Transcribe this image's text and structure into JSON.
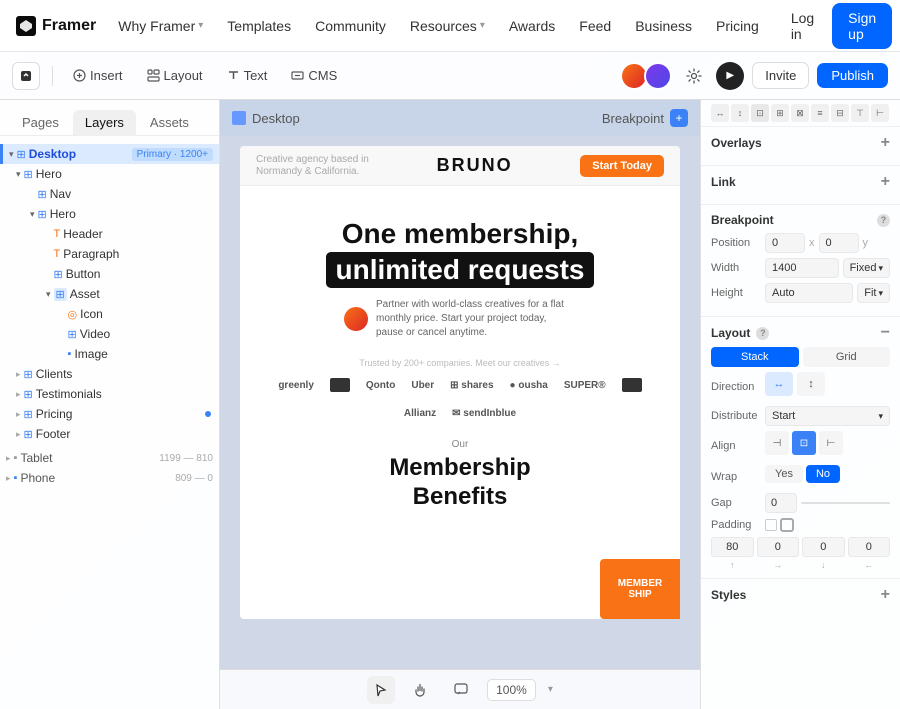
{
  "topnav": {
    "logo_text": "Framer",
    "items": [
      {
        "label": "Why Framer",
        "has_arrow": true
      },
      {
        "label": "Templates",
        "has_arrow": false
      },
      {
        "label": "Community",
        "has_arrow": false
      },
      {
        "label": "Resources",
        "has_arrow": true
      },
      {
        "label": "Awards",
        "has_arrow": false
      },
      {
        "label": "Feed",
        "has_arrow": false
      },
      {
        "label": "Business",
        "has_arrow": false
      },
      {
        "label": "Pricing",
        "has_arrow": false
      }
    ],
    "login_label": "Log in",
    "signup_label": "Sign up"
  },
  "editor": {
    "toolbar": {
      "insert_label": "Insert",
      "layout_label": "Layout",
      "text_label": "Text",
      "cms_label": "CMS",
      "invite_label": "Invite",
      "publish_label": "Publish"
    },
    "panels": {
      "tabs": [
        "Pages",
        "Layers",
        "Assets"
      ],
      "active_tab": "Layers"
    },
    "layers": [
      {
        "id": "desktop",
        "label": "Desktop",
        "indent": 0,
        "badge": "Primary · 1200+",
        "selected": true,
        "icon": "frame",
        "expanded": true
      },
      {
        "id": "hero",
        "label": "Hero",
        "indent": 1,
        "icon": "component",
        "expanded": true
      },
      {
        "id": "nav",
        "label": "Nav",
        "indent": 2,
        "icon": "component"
      },
      {
        "id": "hero2",
        "label": "Hero",
        "indent": 2,
        "icon": "component",
        "expanded": true
      },
      {
        "id": "header",
        "label": "Header",
        "indent": 3,
        "icon": "text"
      },
      {
        "id": "paragraph",
        "label": "Paragraph",
        "indent": 3,
        "icon": "text"
      },
      {
        "id": "button",
        "label": "Button",
        "indent": 3,
        "icon": "component"
      },
      {
        "id": "asset",
        "label": "Asset",
        "indent": 3,
        "icon": "component",
        "expanded": true
      },
      {
        "id": "icon",
        "label": "Icon",
        "indent": 4,
        "icon": "component"
      },
      {
        "id": "video",
        "label": "Video",
        "indent": 4,
        "icon": "component"
      },
      {
        "id": "image",
        "label": "Image",
        "indent": 4,
        "icon": "rect"
      },
      {
        "id": "clients",
        "label": "Clients",
        "indent": 1,
        "icon": "component"
      },
      {
        "id": "testimonials",
        "label": "Testimonials",
        "indent": 1,
        "icon": "component"
      },
      {
        "id": "pricing",
        "label": "Pricing",
        "indent": 1,
        "icon": "component"
      },
      {
        "id": "footer",
        "label": "Footer",
        "indent": 1,
        "icon": "component"
      }
    ],
    "breakpoints": [
      {
        "label": "Tablet",
        "range": "1199 — 810",
        "indent": 0
      },
      {
        "label": "Phone",
        "range": "809 — 0",
        "indent": 0
      }
    ],
    "canvas": {
      "frame_label": "Desktop",
      "breakpoint_label": "Breakpoint",
      "zoom": "100%"
    },
    "site_content": {
      "logo": "BRUNO",
      "cta_btn": "Start Today",
      "hero_line1": "One membership,",
      "hero_line2": "unlimited requests",
      "hero_sub": "Partner with world-class creatives for a flat monthly price. Start your project today, pause or cancel anytime.",
      "logos_credit": "Trusted by 200+ companies. Meet our creatives →",
      "logos": [
        "greenly",
        "□",
        "Qonto",
        "Uber",
        "☷ shares",
        "⬤ ousha",
        "SUPER®",
        "■",
        "Allianz",
        "☉ sendInblue"
      ],
      "membership_label": "Our",
      "membership_h2_line1": "Membership",
      "membership_h2_line2": "Benefits"
    },
    "right_panel": {
      "overlays_label": "Overlays",
      "link_label": "Link",
      "breakpoint_label": "Breakpoint",
      "position_label": "Position",
      "position_x": "0",
      "position_y": "0",
      "width_label": "Width",
      "width_value": "1400",
      "width_mode": "Fixed",
      "height_label": "Height",
      "height_value": "Auto",
      "height_mode": "Fit",
      "layout_label": "Layout",
      "type_stack": "Stack",
      "type_grid": "Grid",
      "direction_label": "Direction",
      "distribute_label": "Distribute",
      "distribute_value": "Start",
      "align_label": "Align",
      "wrap_label": "Wrap",
      "wrap_yes": "Yes",
      "wrap_no": "No",
      "gap_label": "Gap",
      "gap_value": "0",
      "padding_label": "Padding",
      "padding_values": [
        "80",
        "0",
        "0",
        "0"
      ],
      "styles_label": "Styles"
    }
  }
}
